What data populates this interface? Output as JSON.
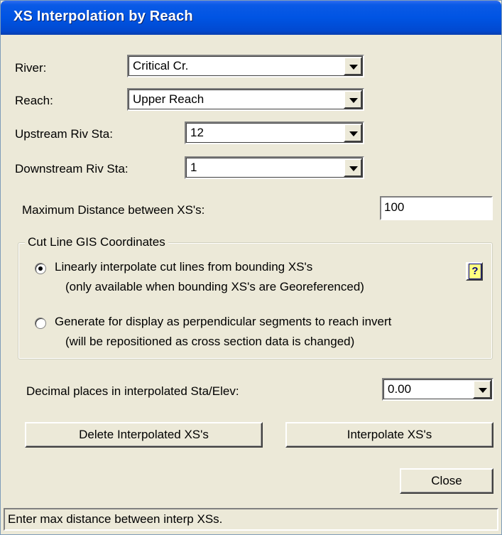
{
  "window": {
    "title": "XS Interpolation by Reach"
  },
  "selection": {
    "river_label": "River:",
    "river_value": "Critical Cr.",
    "reach_label": "Reach:",
    "reach_value": "Upper Reach",
    "upstream_label": "Upstream Riv Sta:",
    "upstream_value": "12",
    "downstream_label": "Downstream Riv Sta:",
    "downstream_value": "1"
  },
  "max_distance": {
    "label": "Maximum  Distance  between XS's:",
    "value": "100"
  },
  "cut_line": {
    "group_title": "Cut Line GIS Coordinates",
    "option1_line1": "Linearly interpolate cut lines from bounding XS's",
    "option1_line2": "(only available when bounding XS's are Georeferenced)",
    "option2_line1": "Generate for display as perpendicular segments to reach invert",
    "option2_line2": "(will be repositioned as cross section data is changed)",
    "selected_option": 1,
    "help_glyph": "?"
  },
  "decimal": {
    "label": "Decimal places in interpolated Sta/Elev:",
    "value": "0.00"
  },
  "buttons": {
    "delete": "Delete Interpolated  XS's",
    "interpolate": "Interpolate XS's",
    "close": "Close"
  },
  "status_bar": {
    "text": "Enter max distance between interp XSs."
  },
  "icons": {
    "dropdown": "chevron-down-icon",
    "help": "help-icon"
  },
  "colors": {
    "title_bar": "#0054e3",
    "dialog_bg": "#ece9d8"
  }
}
